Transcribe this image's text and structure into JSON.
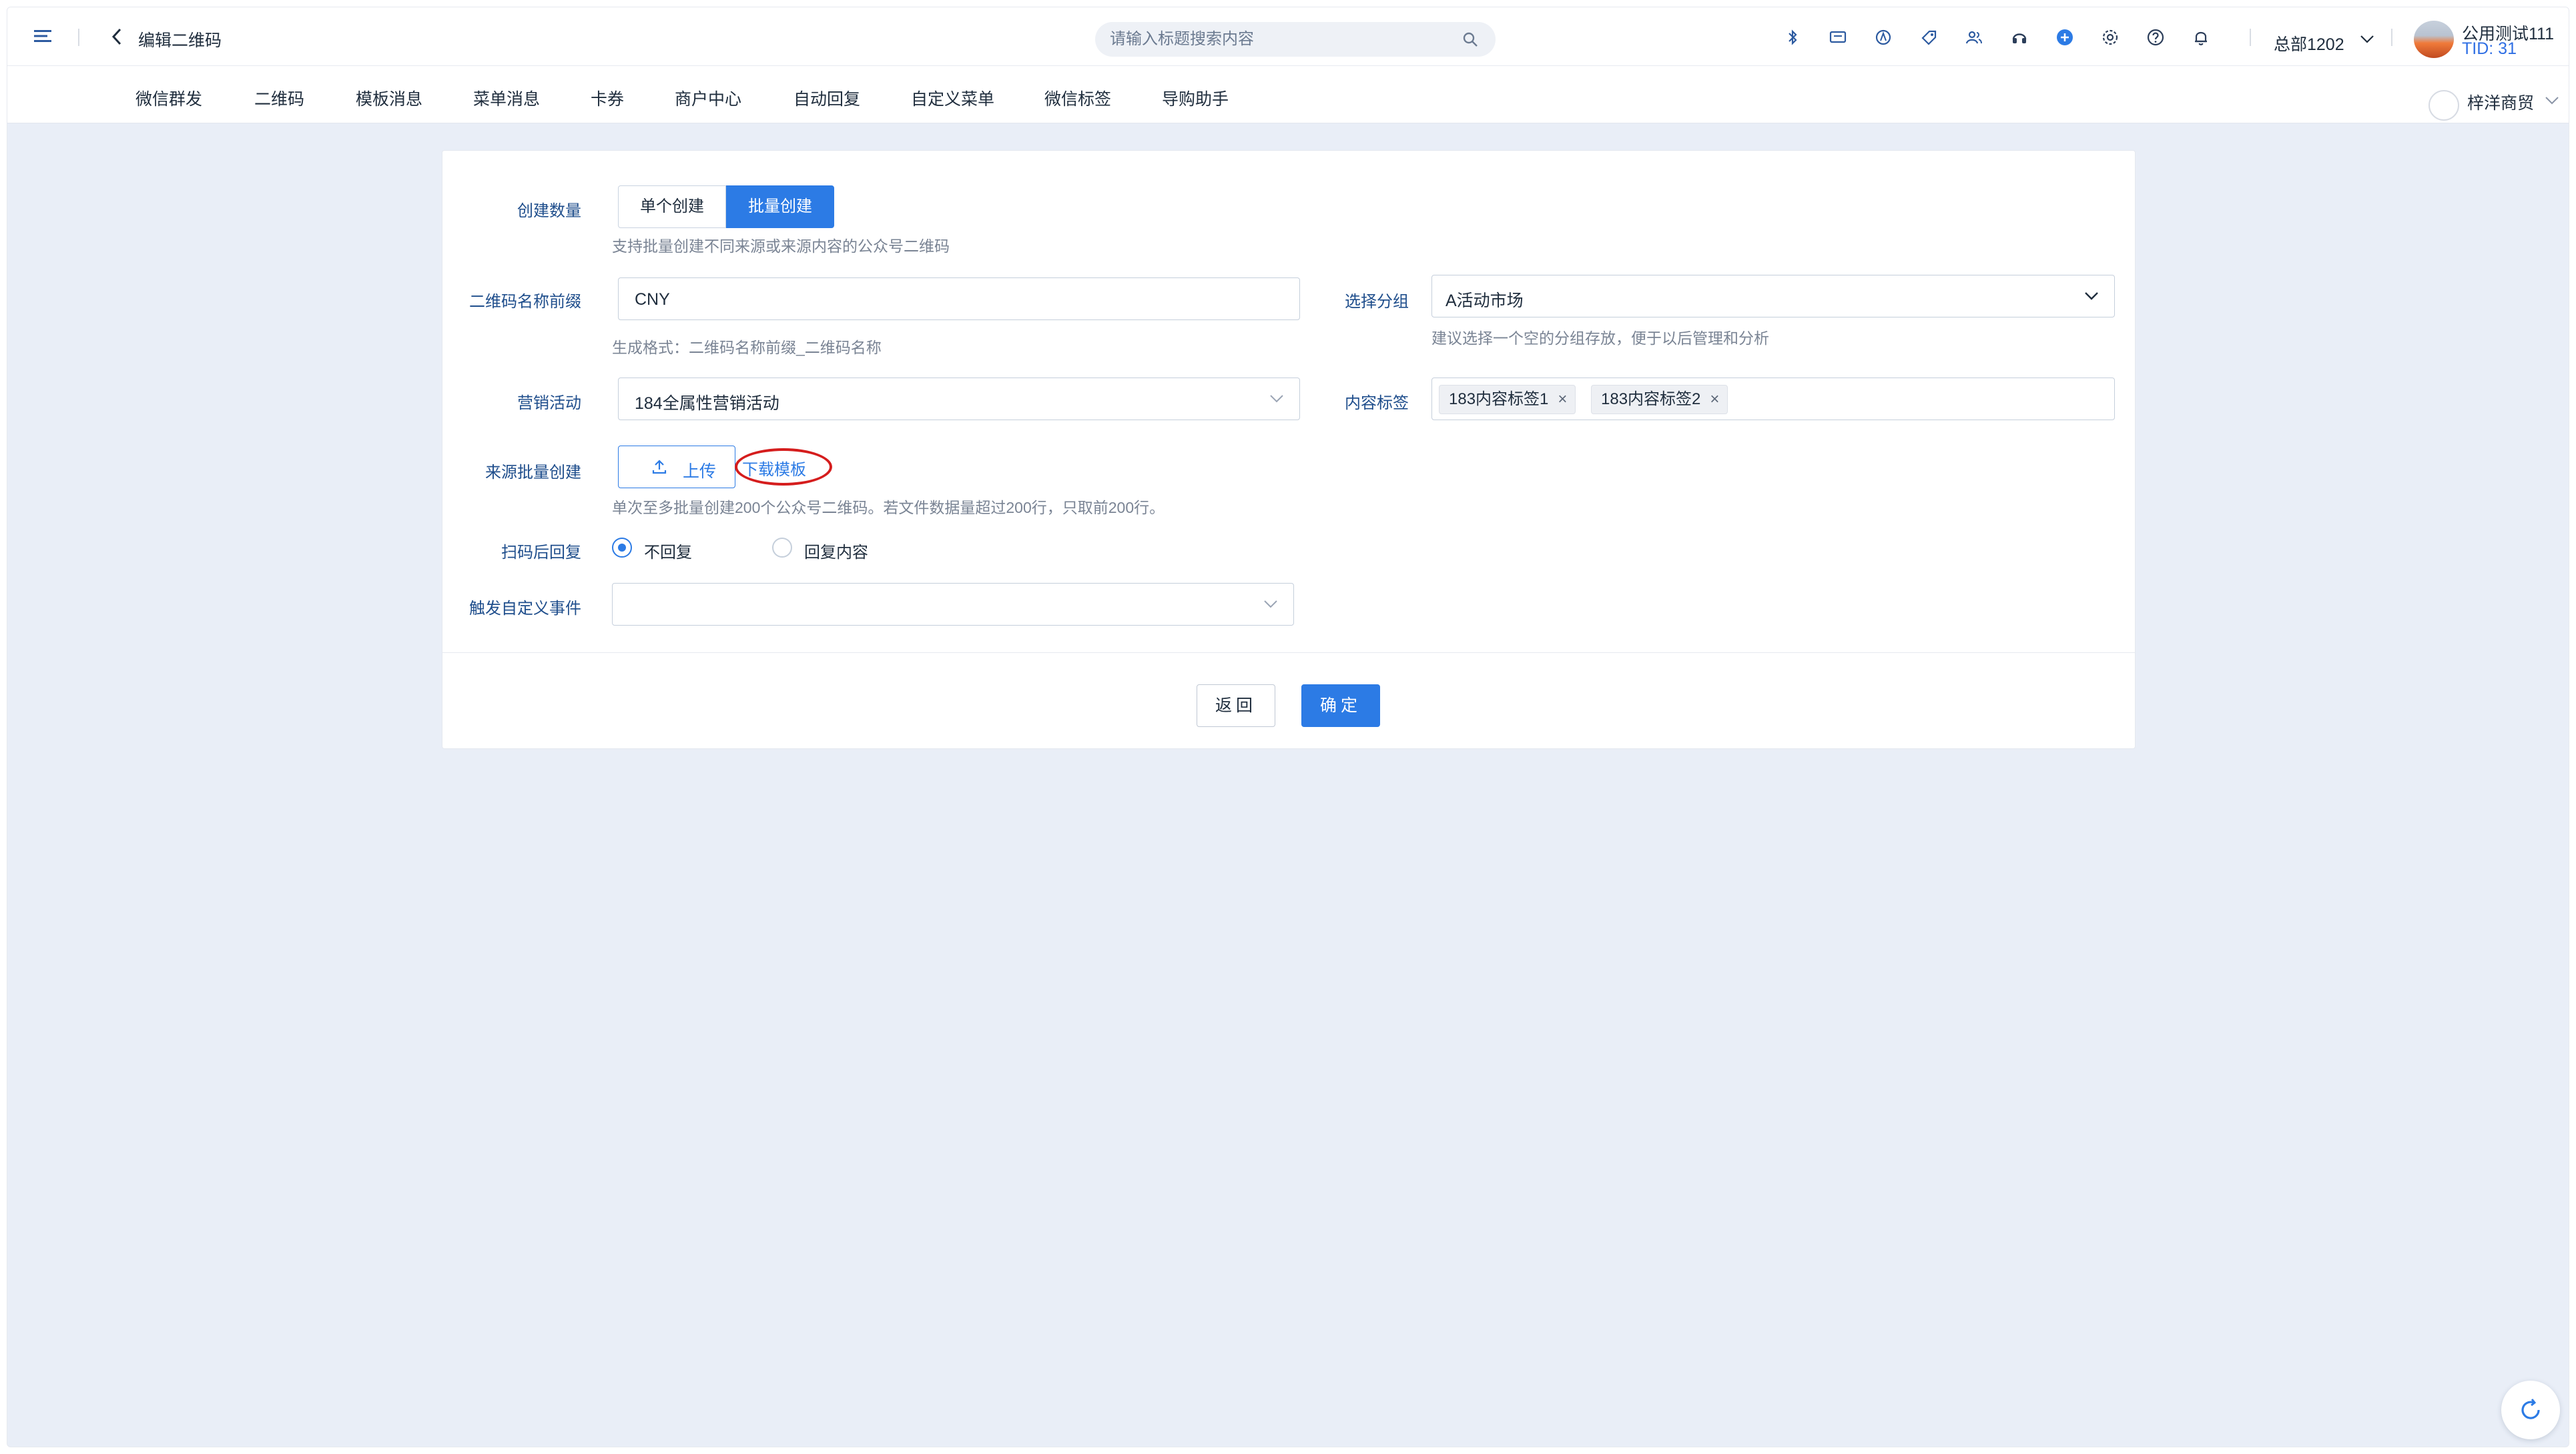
{
  "header": {
    "title": "编辑二维码",
    "search_placeholder": "请输入标题搜索内容",
    "org": "总部1202",
    "user_name": "公用测试111",
    "user_tid": "TID: 31"
  },
  "nav": {
    "items": [
      "微信群发",
      "二维码",
      "模板消息",
      "菜单消息",
      "卡券",
      "商户中心",
      "自动回复",
      "自定义菜单",
      "微信标签",
      "导购助手"
    ],
    "shop_name": "梓洋商贸"
  },
  "form": {
    "create_count": {
      "label": "创建数量",
      "options": [
        "单个创建",
        "批量创建"
      ],
      "selected": "批量创建",
      "hint": "支持批量创建不同来源或来源内容的公众号二维码"
    },
    "name_prefix": {
      "label": "二维码名称前缀",
      "value": "CNY",
      "hint": "生成格式：二维码名称前缀_二维码名称"
    },
    "group": {
      "label": "选择分组",
      "value": "A活动市场",
      "hint": "建议选择一个空的分组存放，便于以后管理和分析"
    },
    "campaign": {
      "label": "营销活动",
      "value": "184全属性营销活动"
    },
    "content_tags": {
      "label": "内容标签",
      "tags": [
        "183内容标签1",
        "183内容标签2"
      ]
    },
    "source_batch": {
      "label": "来源批量创建",
      "upload_label": "上传",
      "download_label": "下载模板",
      "hint": "单次至多批量创建200个公众号二维码。若文件数据量超过200行，只取前200行。"
    },
    "scan_reply": {
      "label": "扫码后回复",
      "options": [
        "不回复",
        "回复内容"
      ],
      "selected": "不回复"
    },
    "custom_event": {
      "label": "触发自定义事件",
      "value": ""
    },
    "buttons": {
      "back": "返回",
      "confirm": "确定"
    }
  },
  "colors": {
    "primary": "#2c7be5",
    "annotation": "#d51d1d",
    "background": "#e9eef7"
  }
}
